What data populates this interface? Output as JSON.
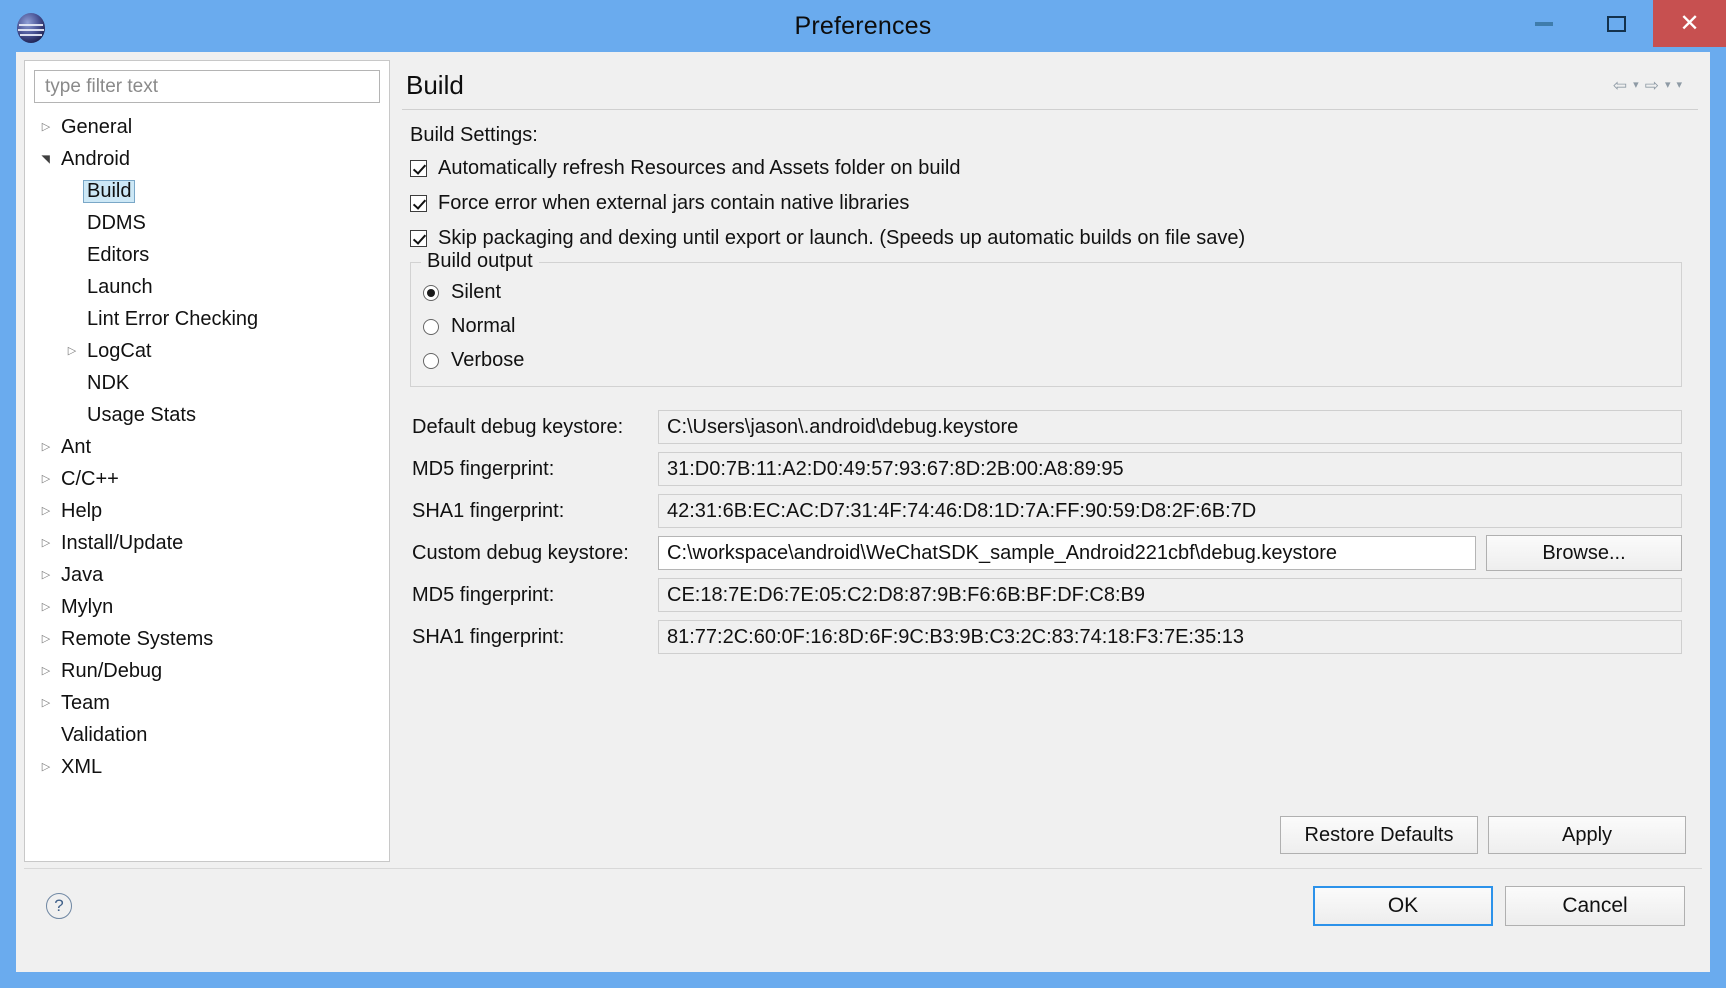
{
  "window": {
    "title": "Preferences",
    "logo_icon": "eclipse-logo-icon",
    "controls": {
      "minimize": "minimize-icon",
      "maximize": "maximize-icon",
      "close": "✕"
    },
    "titlebar_color": "#6aabee",
    "close_button_color": "#c75050"
  },
  "sidebar": {
    "filter": {
      "placeholder": "type filter text",
      "value": ""
    },
    "items": [
      {
        "label": "General",
        "depth": 1,
        "twisty": "collapsed",
        "selected": false
      },
      {
        "label": "Android",
        "depth": 1,
        "twisty": "expanded",
        "selected": false
      },
      {
        "label": "Build",
        "depth": 2,
        "twisty": "none",
        "selected": true
      },
      {
        "label": "DDMS",
        "depth": 2,
        "twisty": "none",
        "selected": false
      },
      {
        "label": "Editors",
        "depth": 2,
        "twisty": "none",
        "selected": false
      },
      {
        "label": "Launch",
        "depth": 2,
        "twisty": "none",
        "selected": false
      },
      {
        "label": "Lint Error Checking",
        "depth": 2,
        "twisty": "none",
        "selected": false
      },
      {
        "label": "LogCat",
        "depth": 2,
        "twisty": "collapsed",
        "selected": false
      },
      {
        "label": "NDK",
        "depth": 2,
        "twisty": "none",
        "selected": false
      },
      {
        "label": "Usage Stats",
        "depth": 2,
        "twisty": "none",
        "selected": false
      },
      {
        "label": "Ant",
        "depth": 1,
        "twisty": "collapsed",
        "selected": false
      },
      {
        "label": "C/C++",
        "depth": 1,
        "twisty": "collapsed",
        "selected": false
      },
      {
        "label": "Help",
        "depth": 1,
        "twisty": "collapsed",
        "selected": false
      },
      {
        "label": "Install/Update",
        "depth": 1,
        "twisty": "collapsed",
        "selected": false
      },
      {
        "label": "Java",
        "depth": 1,
        "twisty": "collapsed",
        "selected": false
      },
      {
        "label": "Mylyn",
        "depth": 1,
        "twisty": "collapsed",
        "selected": false
      },
      {
        "label": "Remote Systems",
        "depth": 1,
        "twisty": "collapsed",
        "selected": false
      },
      {
        "label": "Run/Debug",
        "depth": 1,
        "twisty": "collapsed",
        "selected": false
      },
      {
        "label": "Team",
        "depth": 1,
        "twisty": "collapsed",
        "selected": false
      },
      {
        "label": "Validation",
        "depth": 1,
        "twisty": "none",
        "selected": false
      },
      {
        "label": "XML",
        "depth": 1,
        "twisty": "collapsed",
        "selected": false
      }
    ]
  },
  "detail": {
    "title": "Build",
    "nav": {
      "back": "⇦",
      "back_menu": "▾",
      "forward": "⇨",
      "forward_menu": "▾",
      "view_menu": "▾"
    },
    "settings_label": "Build Settings:",
    "checkboxes": [
      {
        "label": "Automatically refresh Resources and Assets folder on build",
        "checked": true
      },
      {
        "label": "Force error when external jars contain native libraries",
        "checked": true
      },
      {
        "label": "Skip packaging and dexing until export or launch. (Speeds up automatic builds on file save)",
        "checked": true
      }
    ],
    "build_output": {
      "title": "Build output",
      "options": [
        {
          "label": "Silent",
          "selected": true
        },
        {
          "label": "Normal",
          "selected": false
        },
        {
          "label": "Verbose",
          "selected": false
        }
      ]
    },
    "fields": [
      {
        "label": "Default debug keystore:",
        "value": "C:\\Users\\jason\\.android\\debug.keystore",
        "editable": false,
        "has_browse": false
      },
      {
        "label": "MD5 fingerprint:",
        "value": "31:D0:7B:11:A2:D0:49:57:93:67:8D:2B:00:A8:89:95",
        "editable": false,
        "has_browse": false
      },
      {
        "label": "SHA1 fingerprint:",
        "value": "42:31:6B:EC:AC:D7:31:4F:74:46:D8:1D:7A:FF:90:59:D8:2F:6B:7D",
        "editable": false,
        "has_browse": false
      },
      {
        "label": "Custom debug keystore:",
        "value": "C:\\workspace\\android\\WeChatSDK_sample_Android221cbf\\debug.keystore",
        "editable": true,
        "has_browse": true,
        "browse_label": "Browse..."
      },
      {
        "label": "MD5 fingerprint:",
        "value": "CE:18:7E:D6:7E:05:C2:D8:87:9B:F6:6B:BF:DF:C8:B9",
        "editable": false,
        "has_browse": false
      },
      {
        "label": "SHA1 fingerprint:",
        "value": "81:77:2C:60:0F:16:8D:6F:9C:B3:9B:C3:2C:83:74:18:F3:7E:35:13",
        "editable": false,
        "has_browse": false
      }
    ],
    "restore_defaults_label": "Restore Defaults",
    "apply_label": "Apply"
  },
  "footer": {
    "help_icon": "question-mark-icon",
    "help_glyph": "?",
    "ok_label": "OK",
    "cancel_label": "Cancel",
    "default_button_color": "#2c92ea"
  }
}
